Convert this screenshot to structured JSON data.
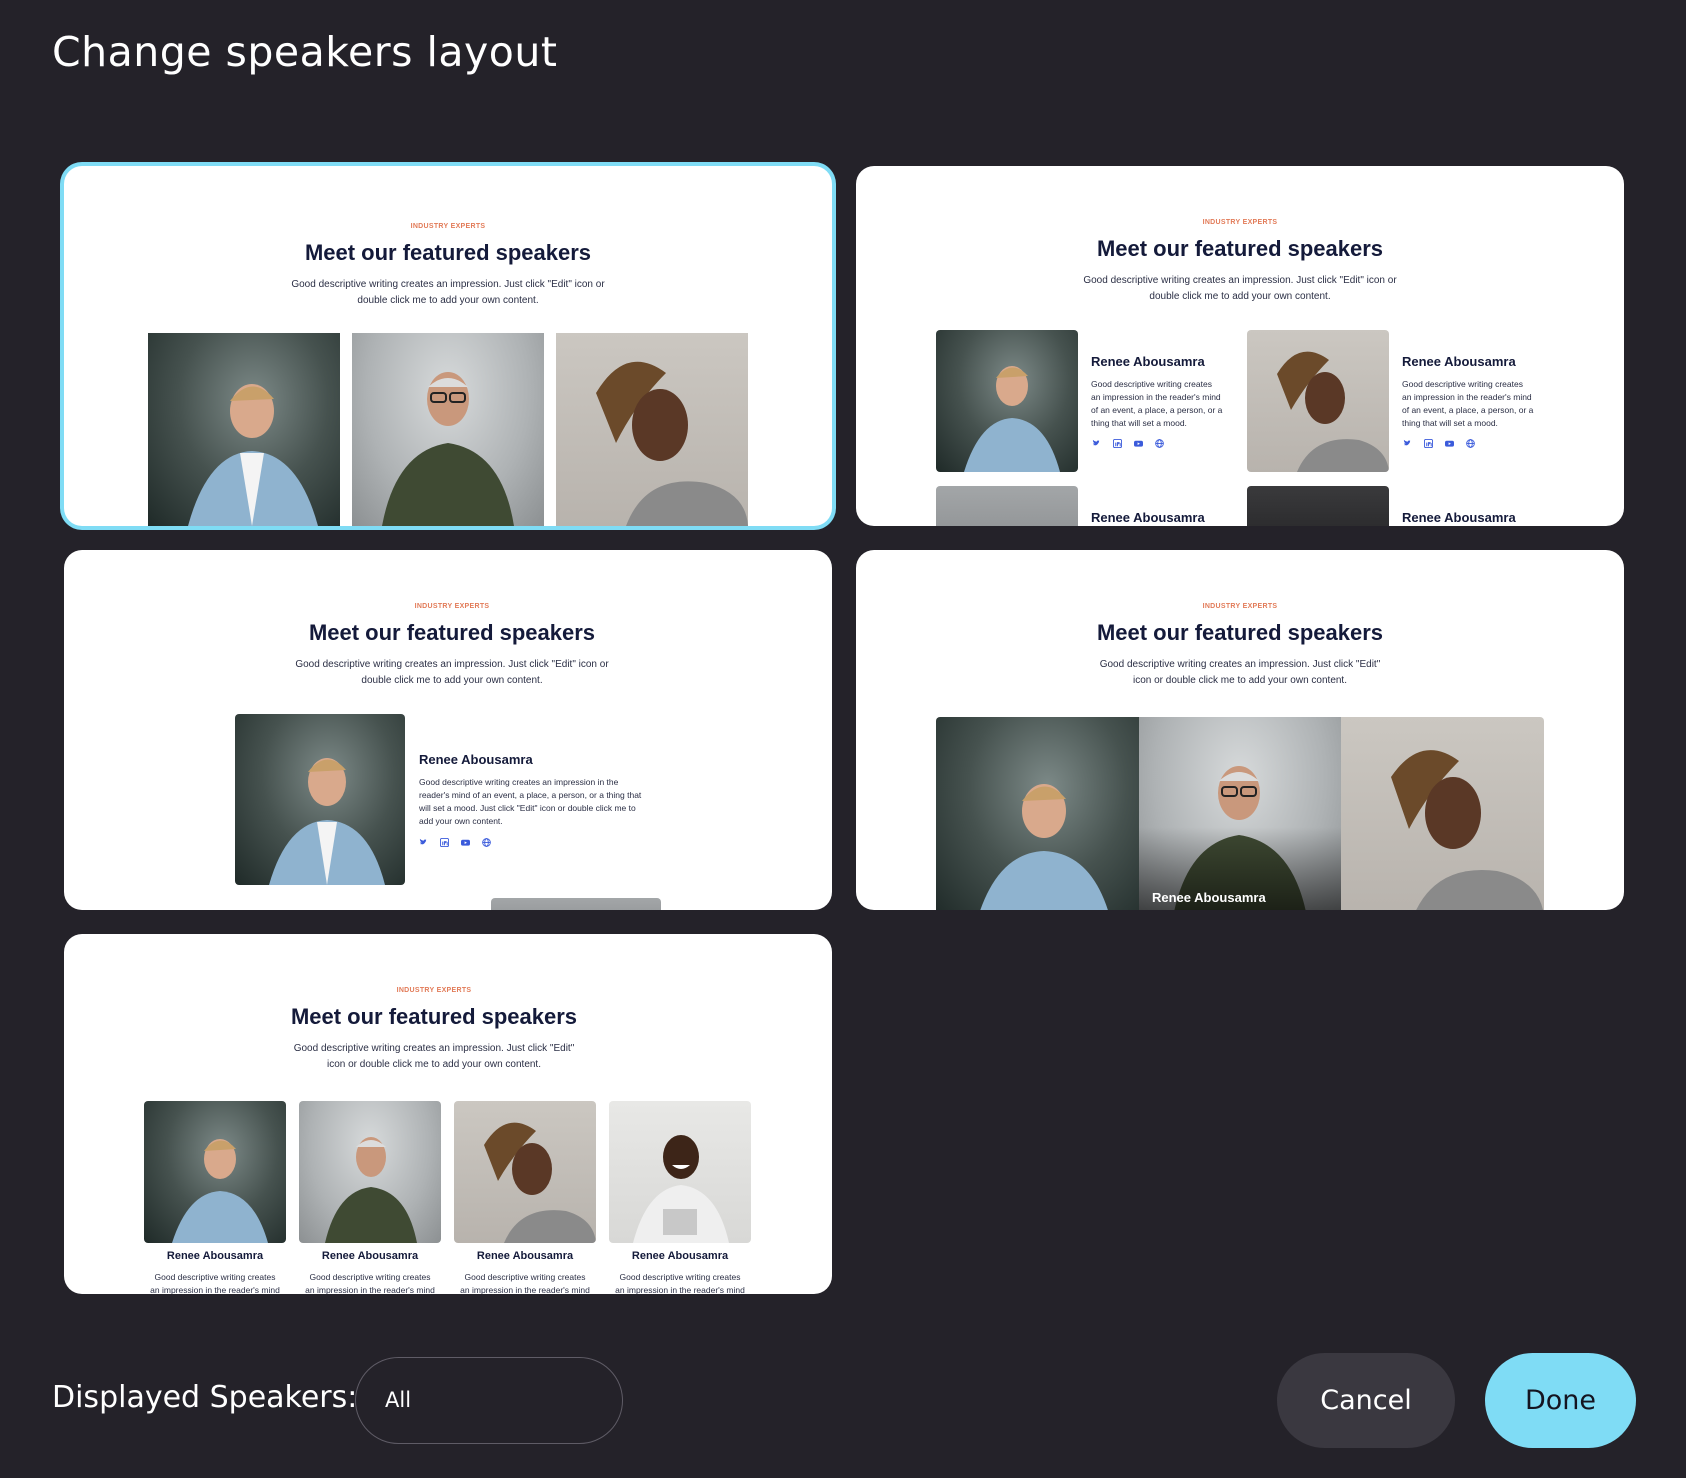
{
  "modal": {
    "title": "Change speakers layout"
  },
  "preview": {
    "kicker": "INDUSTRY EXPERTS",
    "headline": "Meet our featured speakers",
    "desc_a1": "Good descriptive writing creates an impression. Just click \"Edit\" icon or",
    "desc_a2": "double click me to add your own content.",
    "desc_b1": "Good descriptive writing creates an impression. Just click \"Edit\"",
    "desc_b2": "icon or double click me to add your own content.",
    "speaker_name": "Renee Abousamra",
    "bio_short": [
      "Good descriptive writing creates",
      "an impression in the reader's mind",
      "of an event, a place, a person, or a",
      "thing that will set a mood."
    ],
    "bio_long": [
      "Good descriptive writing creates an impression in the",
      "reader's mind of an event, a place, a person, or a thing that",
      "will set a mood. Just click \"Edit\" icon or double click me to",
      "add your own content."
    ],
    "bio_grid": [
      "Good descriptive writing creates",
      "an impression in the reader's mind"
    ]
  },
  "social_icons": [
    "twitter-icon",
    "linkedin-icon",
    "youtube-icon",
    "globe-icon"
  ],
  "layouts": [
    {
      "id": "layout-grid-photos",
      "selected": true
    },
    {
      "id": "layout-two-column-bio",
      "selected": false
    },
    {
      "id": "layout-single-row-bio",
      "selected": false
    },
    {
      "id": "layout-photo-strip",
      "selected": false
    },
    {
      "id": "layout-four-column-cards",
      "selected": false
    }
  ],
  "footer": {
    "displayed_label": "Displayed Speakers:",
    "displayed_value": "All",
    "cancel_label": "Cancel",
    "done_label": "Done"
  },
  "colors": {
    "background": "#242229",
    "accent": "#7fdcf5",
    "kicker": "#e27b58",
    "headline": "#141a3a",
    "social": "#3b5bdb"
  }
}
